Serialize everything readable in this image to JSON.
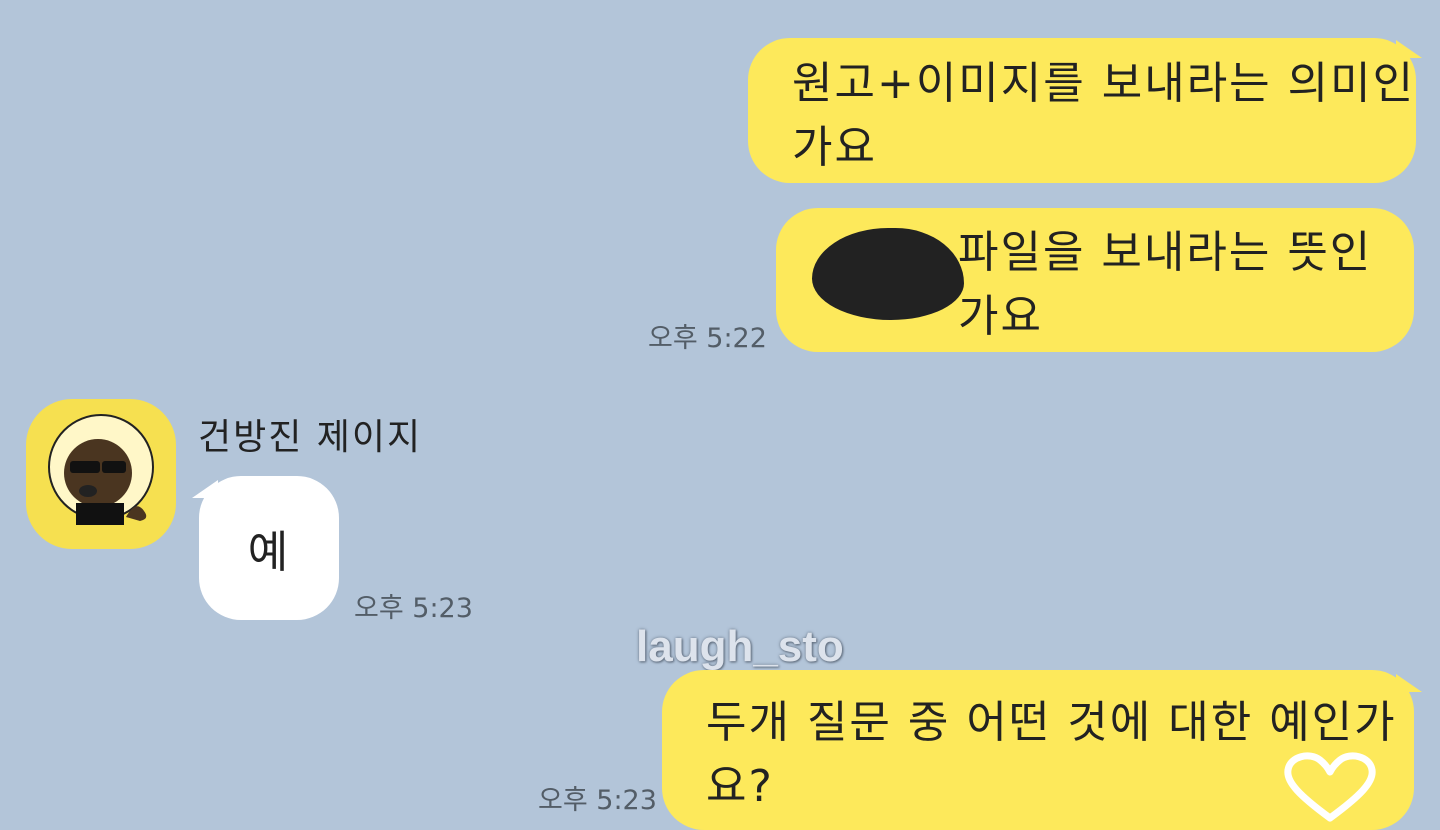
{
  "messages": [
    {
      "id": "m1",
      "sender": "me",
      "text": "원고+이미지를 보내라는 의미인가요"
    },
    {
      "id": "m2",
      "sender": "me",
      "text": "파일을 보내라는 뜻인가요",
      "time": "오후 5:22"
    },
    {
      "id": "m3",
      "sender": "other",
      "name": "건방진 제이지",
      "text": "예",
      "time": "오후 5:23"
    },
    {
      "id": "m4",
      "sender": "me",
      "text": "두개 질문 중 어떤 것에 대한 예인가요?",
      "time": "오후 5:23"
    }
  ],
  "watermark": "laugh_sto",
  "colors": {
    "background": "#b3c5d9",
    "my_bubble": "#fde95b",
    "other_bubble": "#ffffff",
    "avatar_bg": "#f6e050"
  },
  "icons": [
    "avatar-character",
    "heart-icon"
  ]
}
